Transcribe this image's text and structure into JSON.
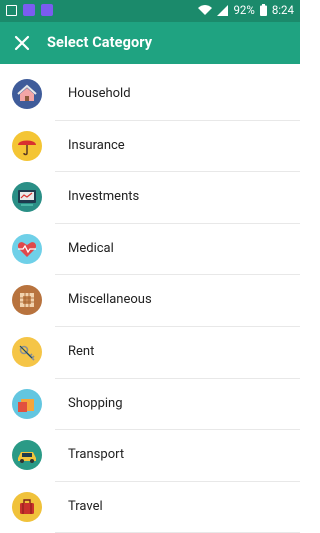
{
  "status_bar": {
    "battery": "92%",
    "time": "8:24",
    "icons": [
      "image-icon",
      "purple-app-icon",
      "purple-app-icon",
      "wifi-icon",
      "signal-icon",
      "battery-icon"
    ]
  },
  "app_bar": {
    "title": "Select Category",
    "close_icon": "close-icon",
    "color": "#1fa381"
  },
  "categories": [
    {
      "label": "Household",
      "icon": "household-icon",
      "color": "#3f5c9a"
    },
    {
      "label": "Insurance",
      "icon": "insurance-icon",
      "color": "#f4c534"
    },
    {
      "label": "Investments",
      "icon": "investments-icon",
      "color": "#2a8f86"
    },
    {
      "label": "Medical",
      "icon": "medical-icon",
      "color": "#6fd0e8"
    },
    {
      "label": "Miscellaneous",
      "icon": "miscellaneous-icon",
      "color": "#b8733e"
    },
    {
      "label": "Rent",
      "icon": "rent-icon",
      "color": "#f5c547"
    },
    {
      "label": "Shopping",
      "icon": "shopping-icon",
      "color": "#63c6e0"
    },
    {
      "label": "Transport",
      "icon": "transport-icon",
      "color": "#2a9a86"
    },
    {
      "label": "Travel",
      "icon": "travel-icon",
      "color": "#f0c23b"
    }
  ]
}
